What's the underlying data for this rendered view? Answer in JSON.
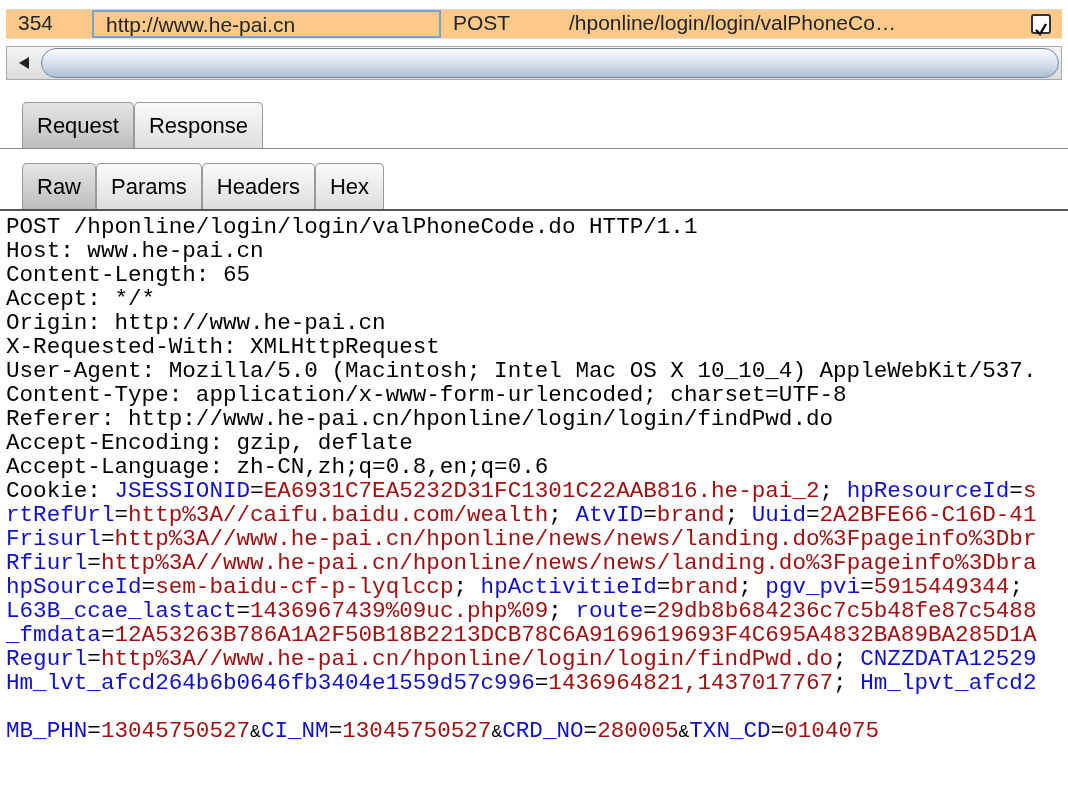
{
  "history_row": {
    "number": "354",
    "host": "http://www.he-pai.cn",
    "method": "POST",
    "url": "/hponline/login/login/valPhoneCo…",
    "selected": true,
    "checked": true
  },
  "message_tabs": [
    {
      "label": "Request",
      "selected": true
    },
    {
      "label": "Response",
      "selected": false
    }
  ],
  "view_tabs": [
    {
      "label": "Raw",
      "selected": true
    },
    {
      "label": "Params",
      "selected": false
    },
    {
      "label": "Headers",
      "selected": false
    },
    {
      "label": "Hex",
      "selected": false
    }
  ],
  "message_lines": [
    {
      "kind": "text",
      "segments": [
        {
          "kind": "plain",
          "text": "POST /hponline/login/login/valPhoneCode.do HTTP/1.1"
        }
      ]
    },
    {
      "kind": "text",
      "segments": [
        {
          "kind": "plain",
          "text": "Host: www.he-pai.cn"
        }
      ]
    },
    {
      "kind": "text",
      "segments": [
        {
          "kind": "plain",
          "text": "Content-Length: 65"
        }
      ]
    },
    {
      "kind": "text",
      "segments": [
        {
          "kind": "plain",
          "text": "Accept: */*"
        }
      ]
    },
    {
      "kind": "text",
      "segments": [
        {
          "kind": "plain",
          "text": "Origin: http://www.he-pai.cn"
        }
      ]
    },
    {
      "kind": "text",
      "segments": [
        {
          "kind": "plain",
          "text": "X-Requested-With: XMLHttpRequest"
        }
      ]
    },
    {
      "kind": "text",
      "segments": [
        {
          "kind": "plain",
          "text": "User-Agent: Mozilla/5.0 (Macintosh; Intel Mac OS X 10_10_4) AppleWebKit/537."
        }
      ]
    },
    {
      "kind": "text",
      "segments": [
        {
          "kind": "plain",
          "text": "Content-Type: application/x-www-form-urlencoded; charset=UTF-8"
        }
      ]
    },
    {
      "kind": "text",
      "segments": [
        {
          "kind": "plain",
          "text": "Referer: http://www.he-pai.cn/hponline/login/login/findPwd.do"
        }
      ]
    },
    {
      "kind": "text",
      "segments": [
        {
          "kind": "plain",
          "text": "Accept-Encoding: gzip, deflate"
        }
      ]
    },
    {
      "kind": "text",
      "segments": [
        {
          "kind": "plain",
          "text": "Accept-Language: zh-CN,zh;q=0.8,en;q=0.6"
        }
      ]
    },
    {
      "kind": "text",
      "segments": [
        {
          "kind": "plain",
          "text": "Cookie: "
        },
        {
          "kind": "name",
          "text": "JSESSIONID"
        },
        {
          "kind": "plain",
          "text": "="
        },
        {
          "kind": "value",
          "text": "EA6931C7EA5232D31FC1301C22AAB816.he-pai_2"
        },
        {
          "kind": "plain",
          "text": "; "
        },
        {
          "kind": "name",
          "text": "hpResourceId"
        },
        {
          "kind": "plain",
          "text": "="
        },
        {
          "kind": "value",
          "text": "s"
        }
      ]
    },
    {
      "kind": "text",
      "segments": [
        {
          "kind": "name",
          "text": "rtRefUrl"
        },
        {
          "kind": "plain",
          "text": "="
        },
        {
          "kind": "value",
          "text": "http%3A//caifu.baidu.com/wealth"
        },
        {
          "kind": "plain",
          "text": "; "
        },
        {
          "kind": "name",
          "text": "AtvID"
        },
        {
          "kind": "plain",
          "text": "="
        },
        {
          "kind": "value",
          "text": "brand"
        },
        {
          "kind": "plain",
          "text": "; "
        },
        {
          "kind": "name",
          "text": "Uuid"
        },
        {
          "kind": "plain",
          "text": "="
        },
        {
          "kind": "value",
          "text": "2A2BFE66-C16D-41"
        }
      ]
    },
    {
      "kind": "text",
      "segments": [
        {
          "kind": "name",
          "text": "Frisurl"
        },
        {
          "kind": "plain",
          "text": "="
        },
        {
          "kind": "value",
          "text": "http%3A//www.he-pai.cn/hponline/news/news/landing.do%3Fpageinfo%3Dbr"
        }
      ]
    },
    {
      "kind": "text",
      "segments": [
        {
          "kind": "name",
          "text": "Rfiurl"
        },
        {
          "kind": "plain",
          "text": "="
        },
        {
          "kind": "value",
          "text": "http%3A//www.he-pai.cn/hponline/news/news/landing.do%3Fpageinfo%3Dbra"
        }
      ]
    },
    {
      "kind": "text",
      "segments": [
        {
          "kind": "name",
          "text": "hpSourceId"
        },
        {
          "kind": "plain",
          "text": "="
        },
        {
          "kind": "value",
          "text": "sem-baidu-cf-p-lyqlccp"
        },
        {
          "kind": "plain",
          "text": "; "
        },
        {
          "kind": "name",
          "text": "hpActivitieId"
        },
        {
          "kind": "plain",
          "text": "="
        },
        {
          "kind": "value",
          "text": "brand"
        },
        {
          "kind": "plain",
          "text": "; "
        },
        {
          "kind": "name",
          "text": "pgv_pvi"
        },
        {
          "kind": "plain",
          "text": "="
        },
        {
          "kind": "value",
          "text": "5915449344"
        },
        {
          "kind": "plain",
          "text": ";"
        }
      ]
    },
    {
      "kind": "text",
      "segments": [
        {
          "kind": "name",
          "text": "L63B_ccae_lastact"
        },
        {
          "kind": "plain",
          "text": "="
        },
        {
          "kind": "value",
          "text": "1436967439%09uc.php%09"
        },
        {
          "kind": "plain",
          "text": "; "
        },
        {
          "kind": "name",
          "text": "route"
        },
        {
          "kind": "plain",
          "text": "="
        },
        {
          "kind": "value",
          "text": "29db8b684236c7c5b48fe87c5488"
        }
      ]
    },
    {
      "kind": "text",
      "segments": [
        {
          "kind": "name",
          "text": "_fmdata"
        },
        {
          "kind": "plain",
          "text": "="
        },
        {
          "kind": "value",
          "text": "12A53263B786A1A2F50B18B2213DCB78C6A9169619693F4C695A4832BA89BA285D1A"
        }
      ]
    },
    {
      "kind": "text",
      "segments": [
        {
          "kind": "name",
          "text": "Regurl"
        },
        {
          "kind": "plain",
          "text": "="
        },
        {
          "kind": "value",
          "text": "http%3A//www.he-pai.cn/hponline/login/login/findPwd.do"
        },
        {
          "kind": "plain",
          "text": "; "
        },
        {
          "kind": "name",
          "text": "CNZZDATA12529"
        }
      ]
    },
    {
      "kind": "text",
      "segments": [
        {
          "kind": "name",
          "text": "Hm_lvt_afcd264b6b0646fb3404e1559d57c996"
        },
        {
          "kind": "plain",
          "text": "="
        },
        {
          "kind": "value",
          "text": "1436964821,1437017767"
        },
        {
          "kind": "plain",
          "text": "; "
        },
        {
          "kind": "name",
          "text": "Hm_lpvt_afcd2"
        }
      ]
    },
    {
      "kind": "blank"
    },
    {
      "kind": "text",
      "segments": [
        {
          "kind": "name",
          "text": "MB_PHN"
        },
        {
          "kind": "plain",
          "text": "="
        },
        {
          "kind": "value",
          "text": "13045750527"
        },
        {
          "kind": "amp",
          "text": "&"
        },
        {
          "kind": "name",
          "text": "CI_NM"
        },
        {
          "kind": "plain",
          "text": "="
        },
        {
          "kind": "value",
          "text": "13045750527"
        },
        {
          "kind": "amp",
          "text": "&"
        },
        {
          "kind": "name",
          "text": "CRD_NO"
        },
        {
          "kind": "plain",
          "text": "="
        },
        {
          "kind": "value",
          "text": "280005"
        },
        {
          "kind": "amp",
          "text": "&"
        },
        {
          "kind": "name",
          "text": "TXN_CD"
        },
        {
          "kind": "plain",
          "text": "="
        },
        {
          "kind": "value",
          "text": "0104075"
        }
      ]
    }
  ]
}
